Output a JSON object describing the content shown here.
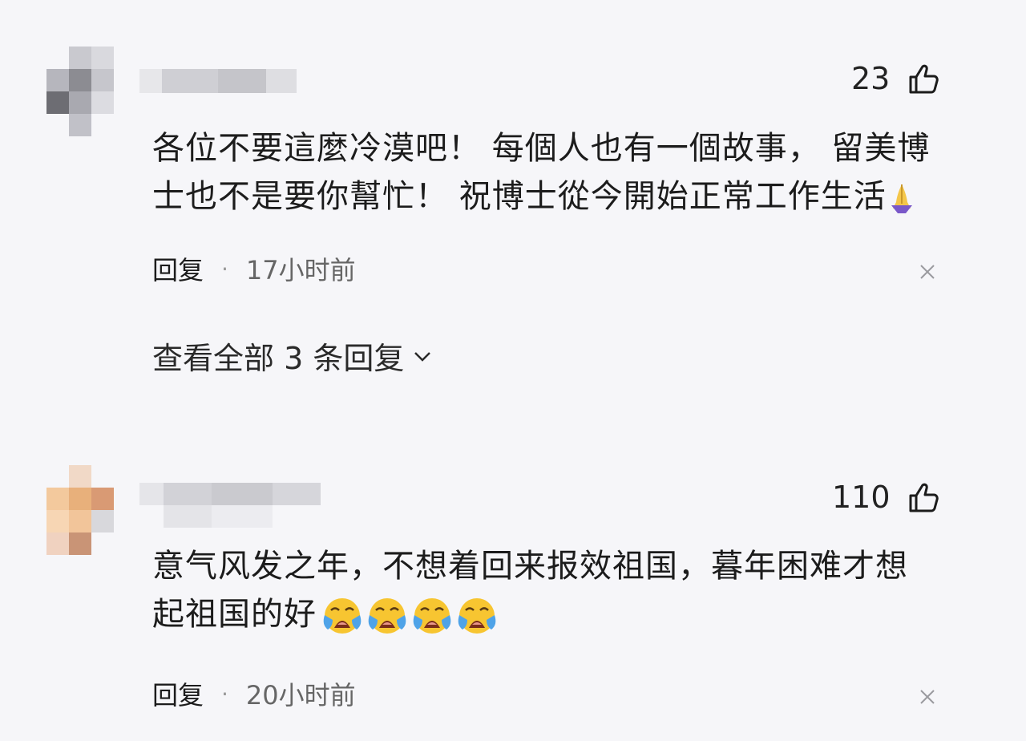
{
  "comments": [
    {
      "likes": "23",
      "text_line1": "各位不要這麼冷漠吧！ 每個人也有一個故事， 留美博",
      "text_line2": "士也不是要你幫忙！ 祝博士從今開始正常工作生活",
      "text_emoji": "folded-hands-icon",
      "reply_label": "回复",
      "separator": "·",
      "time": "17小时前",
      "view_replies": "查看全部 3 条回复"
    },
    {
      "likes": "110",
      "text_line1": "意气风发之年，不想着回来报效祖国，暮年困难才想",
      "text_line2": "起祖国的好",
      "text_emoji": "loudly-crying-face-icon",
      "emoji_count": 4,
      "reply_label": "回复",
      "separator": "·",
      "time": "20小时前"
    }
  ],
  "colors": {
    "background": "#f6f6f9",
    "text": "#1c1c1c",
    "meta": "#666666",
    "emoji_face": "#f7c531"
  }
}
